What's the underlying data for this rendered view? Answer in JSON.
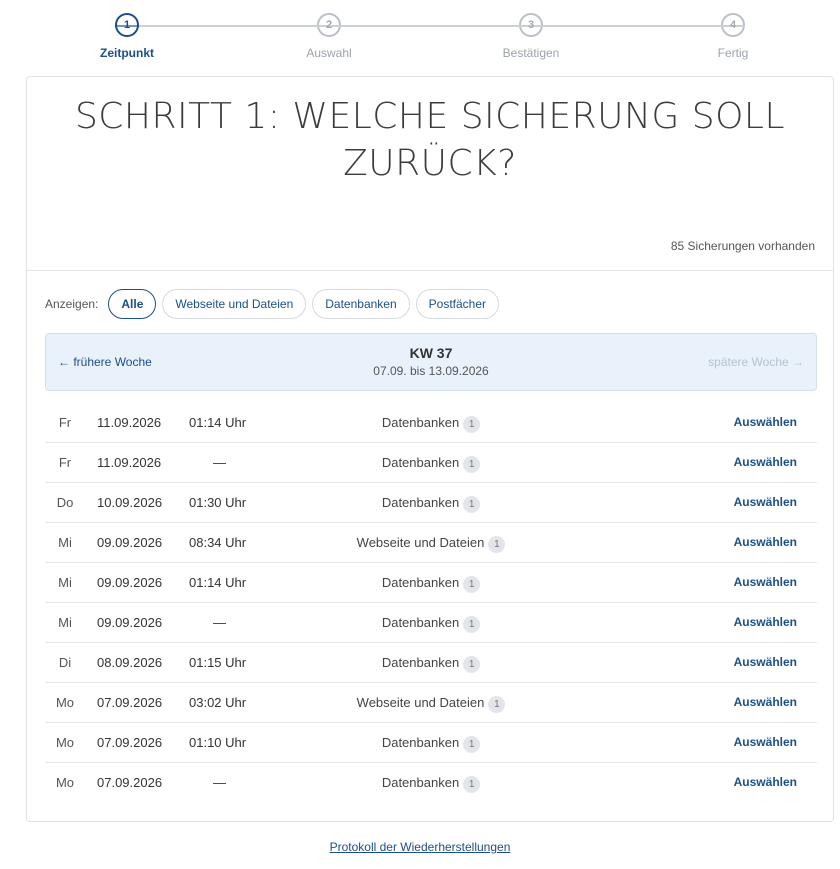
{
  "stepper": {
    "steps": [
      {
        "number": "1",
        "label": "Zeitpunkt",
        "active": true
      },
      {
        "number": "2",
        "label": "Auswahl",
        "active": false
      },
      {
        "number": "3",
        "label": "Bestätigen",
        "active": false
      },
      {
        "number": "4",
        "label": "Fertig",
        "active": false
      }
    ]
  },
  "header": {
    "title": "SCHRITT 1: WELCHE SICHERUNG SOLL ZURÜCK?",
    "count": "85 Sicherungen vorhanden"
  },
  "filter": {
    "label": "Anzeigen:",
    "options": [
      {
        "label": "Alle",
        "active": true
      },
      {
        "label": "Webseite und Dateien",
        "active": false
      },
      {
        "label": "Datenbanken",
        "active": false
      },
      {
        "label": "Postfächer",
        "active": false
      }
    ]
  },
  "week": {
    "prev_label": "← frühere Woche",
    "next_label": "spätere Woche →",
    "kw": "KW 37",
    "range": "07.09. bis 13.09.2026"
  },
  "rows": [
    {
      "day": "Fr",
      "date": "11.09.2026",
      "time": "01:14 Uhr",
      "type": "Datenbanken",
      "count": "1",
      "action": "Auswählen"
    },
    {
      "day": "Fr",
      "date": "11.09.2026",
      "time": "—",
      "type": "Datenbanken",
      "count": "1",
      "action": "Auswählen"
    },
    {
      "day": "Do",
      "date": "10.09.2026",
      "time": "01:30 Uhr",
      "type": "Datenbanken",
      "count": "1",
      "action": "Auswählen"
    },
    {
      "day": "Mi",
      "date": "09.09.2026",
      "time": "08:34 Uhr",
      "type": "Webseite und Dateien",
      "count": "1",
      "action": "Auswählen"
    },
    {
      "day": "Mi",
      "date": "09.09.2026",
      "time": "01:14 Uhr",
      "type": "Datenbanken",
      "count": "1",
      "action": "Auswählen"
    },
    {
      "day": "Mi",
      "date": "09.09.2026",
      "time": "—",
      "type": "Datenbanken",
      "count": "1",
      "action": "Auswählen"
    },
    {
      "day": "Di",
      "date": "08.09.2026",
      "time": "01:15 Uhr",
      "type": "Datenbanken",
      "count": "1",
      "action": "Auswählen"
    },
    {
      "day": "Mo",
      "date": "07.09.2026",
      "time": "03:02 Uhr",
      "type": "Webseite und Dateien",
      "count": "1",
      "action": "Auswählen"
    },
    {
      "day": "Mo",
      "date": "07.09.2026",
      "time": "01:10 Uhr",
      "type": "Datenbanken",
      "count": "1",
      "action": "Auswählen"
    },
    {
      "day": "Mo",
      "date": "07.09.2026",
      "time": "—",
      "type": "Datenbanken",
      "count": "1",
      "action": "Auswählen"
    }
  ],
  "footer": {
    "link_label": "Protokoll der Wiederherstellungen"
  },
  "colors": {
    "accent": "#1c4f8a",
    "week_bg": "#e9f1fa",
    "badge_bg": "#e2e5e9"
  }
}
